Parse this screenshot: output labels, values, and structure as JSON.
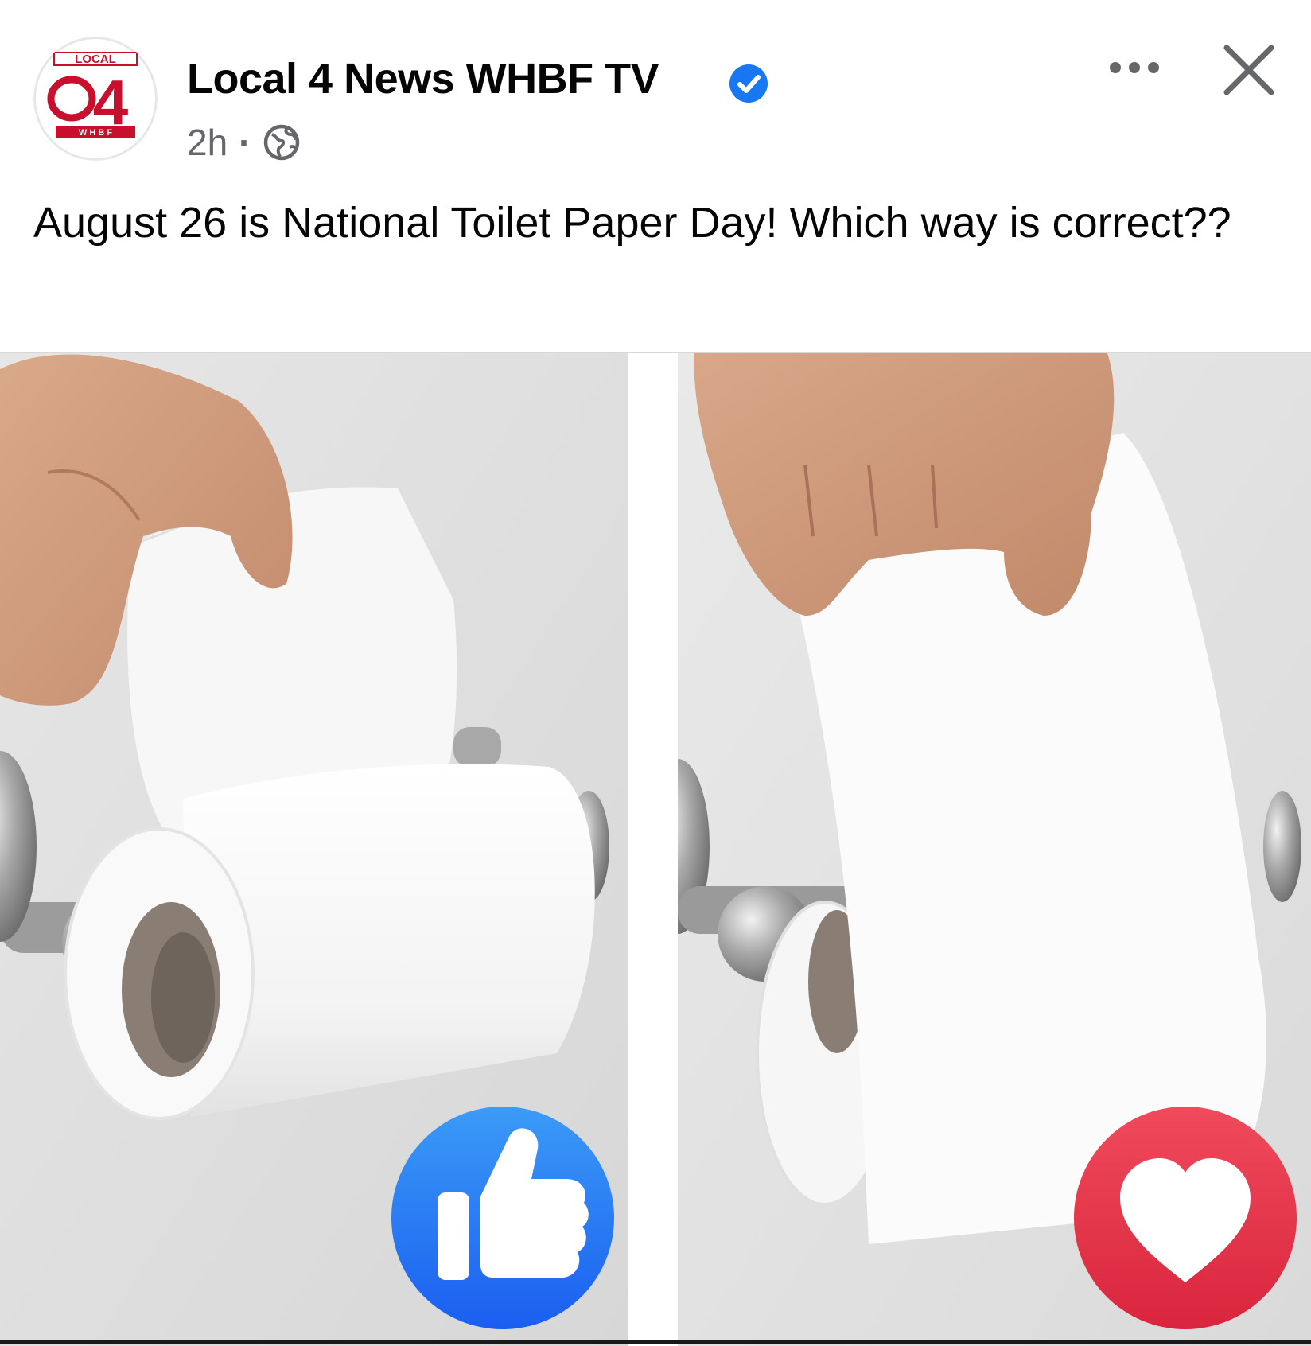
{
  "post": {
    "page_name": "Local 4 News WHBF TV",
    "timestamp": "2h",
    "separator": "·",
    "caption": "August 26 is National Toilet Paper Day! Which way is correct??",
    "avatar_logo": {
      "top_text": "LOCAL",
      "number": "4",
      "bottom_text": "W H B F",
      "colors": {
        "ring": "#c8102e",
        "number": "#c8102e"
      }
    },
    "verified": true,
    "audience_icon": "globe-icon",
    "menu_icon": "more-options-icon",
    "close_icon": "close-icon"
  },
  "image": {
    "left_option": {
      "orientation": "over",
      "reaction": "like",
      "reaction_color": "#1877f2"
    },
    "right_option": {
      "orientation": "under",
      "reaction": "love",
      "reaction_color": "#e4344b"
    }
  },
  "colors": {
    "verified_badge": "#1877f2",
    "meta_text": "#65676b",
    "primary_text": "#050505"
  }
}
